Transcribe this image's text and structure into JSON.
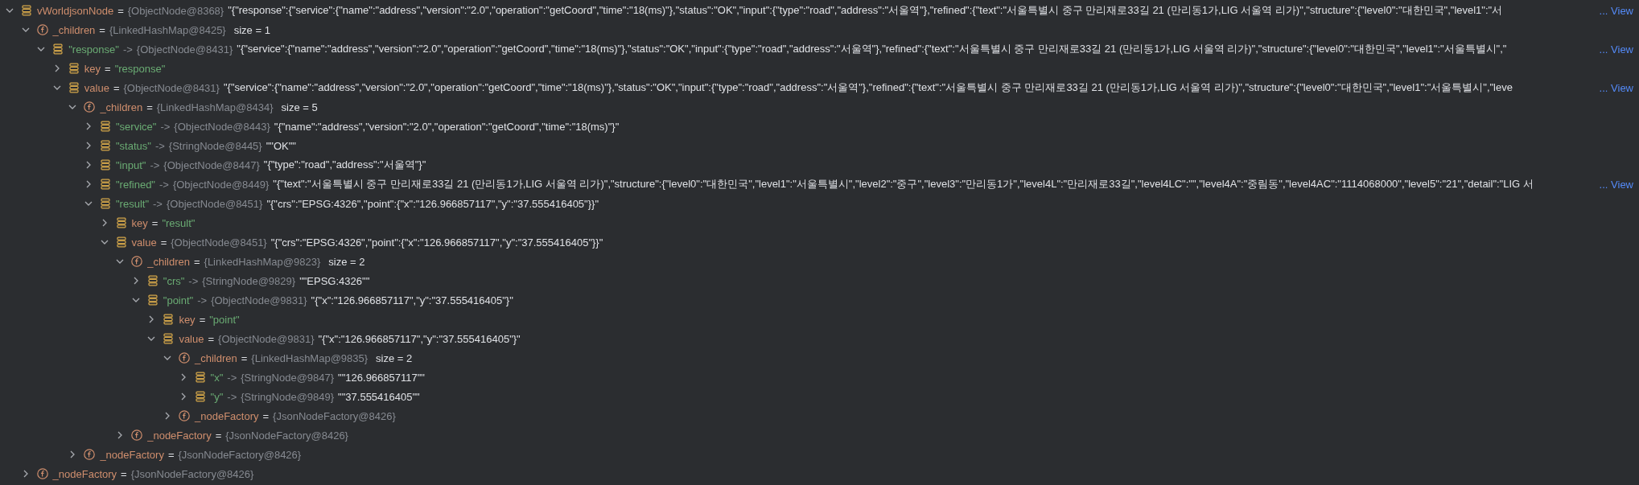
{
  "variables": [
    {
      "kind": "node",
      "name": "vWorldjsonNode",
      "operator": "=",
      "type": "{ObjectNode@8368}",
      "value": "\"{\"response\":{\"service\":{\"name\":\"address\",\"version\":\"2.0\",\"operation\":\"getCoord\",\"time\":\"18(ms)\"},\"status\":\"OK\",\"input\":{\"type\":\"road\",\"address\":\"서울역\"},\"refined\":{\"text\":\"서울특별시 중구 만리재로33길 21 (만리동1가,LIG 서울역 리가)\",\"structure\":{\"level0\":\"대한민국\",\"level1\":\"서",
      "link": "... View",
      "expanded": true,
      "children": [
        {
          "kind": "field",
          "name": "_children",
          "operator": "=",
          "type": "{LinkedHashMap@8425}",
          "size": "size = 1",
          "expanded": true,
          "children": [
            {
              "kind": "entry",
              "name": "\"response\"",
              "operator": "->",
              "type": "{ObjectNode@8431}",
              "value": "\"{\"service\":{\"name\":\"address\",\"version\":\"2.0\",\"operation\":\"getCoord\",\"time\":\"18(ms)\"},\"status\":\"OK\",\"input\":{\"type\":\"road\",\"address\":\"서울역\"},\"refined\":{\"text\":\"서울특별시 중구 만리재로33길 21 (만리동1가,LIG 서울역 리가)\",\"structure\":{\"level0\":\"대한민국\",\"level1\":\"서울특별시\",\"",
              "link": "... View",
              "expanded": true,
              "children": [
                {
                  "kind": "key",
                  "name": "key",
                  "operator": "=",
                  "value": "\"response\"",
                  "expanded": false
                },
                {
                  "kind": "node",
                  "name": "value",
                  "operator": "=",
                  "type": "{ObjectNode@8431}",
                  "value": "\"{\"service\":{\"name\":\"address\",\"version\":\"2.0\",\"operation\":\"getCoord\",\"time\":\"18(ms)\"},\"status\":\"OK\",\"input\":{\"type\":\"road\",\"address\":\"서울역\"},\"refined\":{\"text\":\"서울특별시 중구 만리재로33길 21 (만리동1가,LIG 서울역 리가)\",\"structure\":{\"level0\":\"대한민국\",\"level1\":\"서울특별시\",\"leve",
                  "link": "... View",
                  "expanded": true,
                  "children": [
                    {
                      "kind": "field",
                      "name": "_children",
                      "operator": "=",
                      "type": "{LinkedHashMap@8434}",
                      "size": "size = 5",
                      "expanded": true,
                      "children": [
                        {
                          "kind": "entry",
                          "name": "\"service\"",
                          "operator": "->",
                          "type": "{ObjectNode@8443}",
                          "value": "\"{\"name\":\"address\",\"version\":\"2.0\",\"operation\":\"getCoord\",\"time\":\"18(ms)\"}\"",
                          "expanded": false
                        },
                        {
                          "kind": "entry",
                          "name": "\"status\"",
                          "operator": "->",
                          "type": "{StringNode@8445}",
                          "value": "\"\"OK\"\"",
                          "expanded": false
                        },
                        {
                          "kind": "entry",
                          "name": "\"input\"",
                          "operator": "->",
                          "type": "{ObjectNode@8447}",
                          "value": "\"{\"type\":\"road\",\"address\":\"서울역\"}\"",
                          "expanded": false
                        },
                        {
                          "kind": "entry",
                          "name": "\"refined\"",
                          "operator": "->",
                          "type": "{ObjectNode@8449}",
                          "value": "\"{\"text\":\"서울특별시 중구 만리재로33길 21 (만리동1가,LIG 서울역 리가)\",\"structure\":{\"level0\":\"대한민국\",\"level1\":\"서울특별시\",\"level2\":\"중구\",\"level3\":\"만리동1가\",\"level4L\":\"만리재로33길\",\"level4LC\":\"\",\"level4A\":\"중림동\",\"level4AC\":\"1114068000\",\"level5\":\"21\",\"detail\":\"LIG 서",
                          "link": "... View",
                          "expanded": false
                        },
                        {
                          "kind": "entry",
                          "name": "\"result\"",
                          "operator": "->",
                          "type": "{ObjectNode@8451}",
                          "value": "\"{\"crs\":\"EPSG:4326\",\"point\":{\"x\":\"126.966857117\",\"y\":\"37.555416405\"}}\"",
                          "expanded": true,
                          "children": [
                            {
                              "kind": "key",
                              "name": "key",
                              "operator": "=",
                              "value": "\"result\"",
                              "expanded": false
                            },
                            {
                              "kind": "node",
                              "name": "value",
                              "operator": "=",
                              "type": "{ObjectNode@8451}",
                              "value": "\"{\"crs\":\"EPSG:4326\",\"point\":{\"x\":\"126.966857117\",\"y\":\"37.555416405\"}}\"",
                              "expanded": true,
                              "children": [
                                {
                                  "kind": "field",
                                  "name": "_children",
                                  "operator": "=",
                                  "type": "{LinkedHashMap@9823}",
                                  "size": "size = 2",
                                  "expanded": true,
                                  "children": [
                                    {
                                      "kind": "entry",
                                      "name": "\"crs\"",
                                      "operator": "->",
                                      "type": "{StringNode@9829}",
                                      "value": "\"\"EPSG:4326\"\"",
                                      "expanded": false
                                    },
                                    {
                                      "kind": "entry",
                                      "name": "\"point\"",
                                      "operator": "->",
                                      "type": "{ObjectNode@9831}",
                                      "value": "\"{\"x\":\"126.966857117\",\"y\":\"37.555416405\"}\"",
                                      "expanded": true,
                                      "children": [
                                        {
                                          "kind": "key",
                                          "name": "key",
                                          "operator": "=",
                                          "value": "\"point\"",
                                          "expanded": false
                                        },
                                        {
                                          "kind": "node",
                                          "name": "value",
                                          "operator": "=",
                                          "type": "{ObjectNode@9831}",
                                          "value": "\"{\"x\":\"126.966857117\",\"y\":\"37.555416405\"}\"",
                                          "expanded": true,
                                          "children": [
                                            {
                                              "kind": "field",
                                              "name": "_children",
                                              "operator": "=",
                                              "type": "{LinkedHashMap@9835}",
                                              "size": "size = 2",
                                              "expanded": true,
                                              "children": [
                                                {
                                                  "kind": "entry",
                                                  "name": "\"x\"",
                                                  "operator": "->",
                                                  "type": "{StringNode@9847}",
                                                  "value": "\"\"126.966857117\"\"",
                                                  "expanded": false
                                                },
                                                {
                                                  "kind": "entry",
                                                  "name": "\"y\"",
                                                  "operator": "->",
                                                  "type": "{StringNode@9849}",
                                                  "value": "\"\"37.555416405\"\"",
                                                  "expanded": false
                                                }
                                              ]
                                            },
                                            {
                                              "kind": "field",
                                              "name": "_nodeFactory",
                                              "operator": "=",
                                              "type": "{JsonNodeFactory@8426}",
                                              "expanded": false
                                            }
                                          ]
                                        }
                                      ]
                                    }
                                  ]
                                },
                                {
                                  "kind": "field",
                                  "name": "_nodeFactory",
                                  "operator": "=",
                                  "type": "{JsonNodeFactory@8426}",
                                  "expanded": false
                                }
                              ]
                            }
                          ]
                        }
                      ]
                    },
                    {
                      "kind": "field",
                      "name": "_nodeFactory",
                      "operator": "=",
                      "type": "{JsonNodeFactory@8426}",
                      "expanded": false
                    }
                  ]
                }
              ]
            }
          ]
        },
        {
          "kind": "field",
          "name": "_nodeFactory",
          "operator": "=",
          "type": "{JsonNodeFactory@8426}",
          "expanded": false
        }
      ]
    }
  ]
}
